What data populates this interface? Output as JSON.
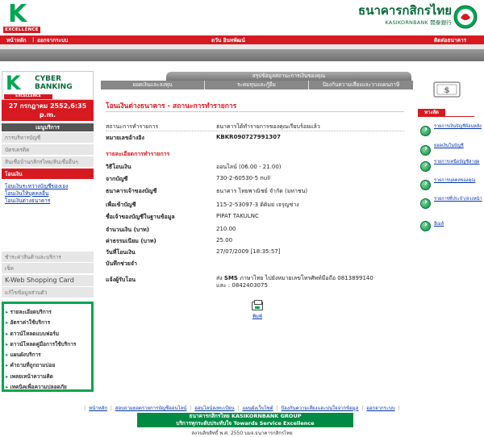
{
  "header": {
    "kx_logo_letter": "K",
    "kx_logo_sub": "EXCELLENCE",
    "bank_name_th": "ธนาคารกสิกรไทย",
    "bank_name_en": "KASIKORNBANK 開泰銀行"
  },
  "topnav": {
    "home": "หน้าหลัก",
    "logout": "ออกจากระบบ",
    "welcome": "ดวัน อินทพัฒน์",
    "contact": "ติดต่อธนาคาร"
  },
  "sidebar": {
    "cyber_title_1": "CYBER",
    "cyber_title_2": "BANKING",
    "cyber_sub": "EXCELLENCE",
    "date": "27 กรกฎาคม 2552,6:35 p.m.",
    "menu_header": "เมนูบริการ",
    "items": [
      "การบริหารบัญชี",
      "บัตรเครดิต",
      "สินเชื่อบ้านกสิกรไทย/สินเชื่ออื่นๆ",
      "โอนเงิน"
    ],
    "submenu": [
      "โอนเงินระหว่างบัญชีของเอง",
      "โอนเงินให้บุคคลอื่น",
      "โอนเงินต่างธนาคาร"
    ],
    "lower_items": [
      "ชำระค่าสินค้าและบริการ",
      "เช็ค"
    ],
    "kweb": "K-Web Shopping Card",
    "edit_item": "แก้ไขข้อมูลส่วนตัว",
    "green_links": [
      "รายละเอียดบริการ",
      "อัตราค่าใช้บริการ",
      "ดาวน์โหลดแบบฟอร์ม",
      "ดาวน์โหลดคู่มือการใช้บริการ",
      "แผนผังบริการ",
      "คำถามที่ถูกถามบ่อย",
      "เพลยเหน้าความคิด",
      "เทคนิคเพื่อความปลอดภัย"
    ]
  },
  "tabs": {
    "title": "สรุปข้อมูลสถานะการเงินของคุณ",
    "items": [
      "ยอดเงินและลงทุน",
      "ระดมทุนและกู้ยืม",
      "ป้องกันความเสี่ยงและวางแผนภาษี"
    ]
  },
  "main": {
    "title": "โอนเงินต่างธนาคาร - สถานะการทำรายการ",
    "status_label": "สถานะการทำรายการ",
    "status_value": "ธนาคารได้ทำรายการของคุณเรียบร้อยแล้ว",
    "ref_label": "หมายเลขอ้างอิง",
    "ref_value": "KBKR090727991307",
    "section_title": "รายละเอียดการทำรายการ",
    "rows": [
      {
        "label": "วิธีโอนเงิน",
        "value": "ออนไลน์ (06.00 - 21.00)"
      },
      {
        "label": "จากบัญชี",
        "value": "730-2-60530-5 null"
      },
      {
        "label": "ธนาคารเจ้าของบัญชี",
        "value": "ธนาคาร ไทยพาณิชย์ จำกัด (มหาชน)"
      },
      {
        "label": "เพื่อเข้าบัญชี",
        "value": "115-2-53097-3 ดิดิมย่ เจรุญช่าง"
      },
      {
        "label": "ชื่อเจ้าของบัญชีในฐานข้อมูล",
        "value": "PIPAT TAKULNC"
      },
      {
        "label": "จำนวนเงิน (บาท)",
        "value": "210.00"
      },
      {
        "label": "ค่าธรรมเนียม (บาท)",
        "value": "25.00"
      },
      {
        "label": "วันที่โอนเงิน",
        "value": "27/07/2009 [18:35:57]"
      },
      {
        "label": "บันทึกช่วยจำ",
        "value": ""
      }
    ],
    "notify_label": "แจ้งผู้รับโอน",
    "notify_line1_a": "ส่ง ",
    "notify_line1_sms": "SMS",
    "notify_line1_b": " ภาษาไทย ไปยังหมายเลขโทรศัพท์มือถือ 0813899140",
    "notify_line2": "และ : 0842403075",
    "print_label": "พิมพ์"
  },
  "right_panel": {
    "head": "ทางลัด",
    "items": [
      "รายการเงินบัญชีย้อนหลัง",
      "ยอดเงินในบัญชี",
      "รายการเหนือบัญชีล่าสุด",
      "รายการบุคคลของคุณ",
      "รายการที่ประจำ/ล่วงหน้า",
      "อีเมล์"
    ]
  },
  "footer": {
    "links": [
      "หน้าหลัก",
      "สอบถามยอดรายการบัญชีออนไลน์",
      "ออนไลน์ลงทะเบียน",
      "แผนผังเว็บไซต์",
      "ป้องกันความเสี่ยงและบ่นใจจากข้อมูล",
      "ออกจากระบบ"
    ],
    "green_line1": "ธนาคารกสิกรไทย  KASIKORNBANK GROUP",
    "green_line2": "บริการทุกระดับประทับใจ  Towards Service Excellence",
    "copyright": "สงวนลิขสิทธิ์ พ.ศ. 2550 บมจ.ธนาคารกสิกรไทย"
  },
  "colors": {
    "brand_green": "#00a651",
    "brand_red": "#d71920"
  }
}
